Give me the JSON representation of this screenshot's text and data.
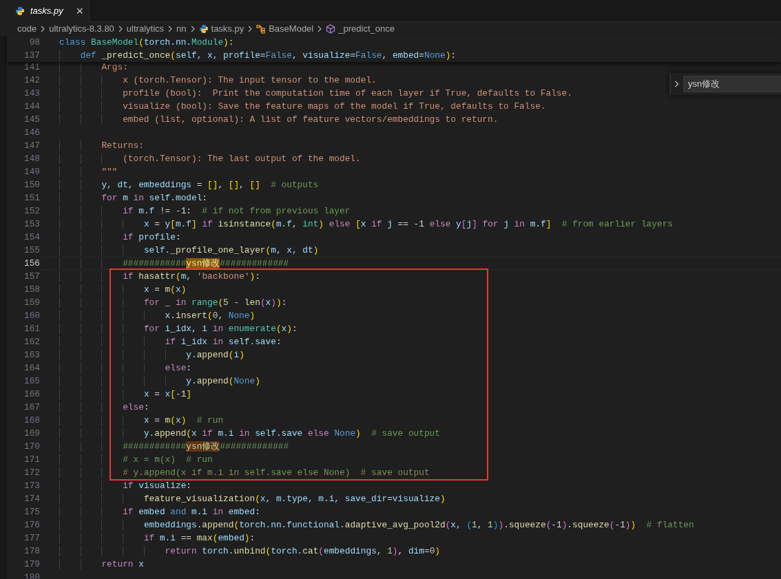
{
  "tab": {
    "title": "tasks.py",
    "close": "×",
    "preview": true
  },
  "breadcrumb": [
    {
      "kind": "folder",
      "label": "code"
    },
    {
      "kind": "folder",
      "label": "ultralytics-8.3.80"
    },
    {
      "kind": "folder",
      "label": "ultralytics"
    },
    {
      "kind": "folder",
      "label": "nn"
    },
    {
      "kind": "python",
      "label": "tasks.py"
    },
    {
      "kind": "class",
      "label": "BaseModel"
    },
    {
      "kind": "method",
      "label": "_predict_once"
    }
  ],
  "find": {
    "value": "ysn修改"
  },
  "sticky_lines": [
    {
      "number": "98",
      "tokens": [
        {
          "kind": "keyword",
          "text": "class "
        },
        {
          "kind": "class",
          "text": "BaseModel"
        },
        {
          "kind": "bracket1",
          "text": "("
        },
        {
          "kind": "variable",
          "text": "torch.nn."
        },
        {
          "kind": "class",
          "text": "Module"
        },
        {
          "kind": "bracket1",
          "text": ")"
        },
        {
          "kind": "plain",
          "text": ":"
        }
      ]
    },
    {
      "number": "137",
      "tokens": [
        {
          "kind": "keyword",
          "text": "    def "
        },
        {
          "kind": "function",
          "text": "_predict_once"
        },
        {
          "kind": "bracket1",
          "text": "("
        },
        {
          "kind": "variable",
          "text": "self, x, profile"
        },
        {
          "kind": "plain",
          "text": "="
        },
        {
          "kind": "keyword",
          "text": "False"
        },
        {
          "kind": "plain",
          "text": ", "
        },
        {
          "kind": "variable",
          "text": "visualize"
        },
        {
          "kind": "plain",
          "text": "="
        },
        {
          "kind": "keyword",
          "text": "False"
        },
        {
          "kind": "plain",
          "text": ", "
        },
        {
          "kind": "variable",
          "text": "embed"
        },
        {
          "kind": "plain",
          "text": "="
        },
        {
          "kind": "keyword",
          "text": "None"
        },
        {
          "kind": "bracket1",
          "text": ")"
        },
        {
          "kind": "plain",
          "text": ":"
        }
      ]
    }
  ],
  "lines": [
    {
      "number": "141",
      "current": false,
      "tokens": [
        {
          "kind": "string",
          "text": "        Args:"
        }
      ]
    },
    {
      "number": "142",
      "current": false,
      "tokens": [
        {
          "kind": "string",
          "text": "            x (torch.Tensor): The input tensor to the model."
        }
      ]
    },
    {
      "number": "143",
      "current": false,
      "tokens": [
        {
          "kind": "string",
          "text": "            profile (bool):  Print the computation time of each layer if True, defaults to False."
        }
      ]
    },
    {
      "number": "144",
      "current": false,
      "tokens": [
        {
          "kind": "string",
          "text": "            visualize (bool): Save the feature maps of the model if True, defaults to False."
        }
      ]
    },
    {
      "number": "145",
      "current": false,
      "tokens": [
        {
          "kind": "string",
          "text": "            embed (list, optional): A list of feature vectors/embeddings to return."
        }
      ]
    },
    {
      "number": "146",
      "current": false
    },
    {
      "number": "147",
      "current": false,
      "tokens": [
        {
          "kind": "string",
          "text": "        Returns:"
        }
      ]
    },
    {
      "number": "148",
      "current": false,
      "tokens": [
        {
          "kind": "string",
          "text": "            (torch.Tensor): The last output of the model."
        }
      ]
    },
    {
      "number": "149",
      "current": false,
      "tokens": [
        {
          "kind": "string",
          "text": "        \"\"\""
        }
      ]
    },
    {
      "number": "150",
      "current": false,
      "tokens": [
        {
          "kind": "variable",
          "text": "        y, dt, embeddings "
        },
        {
          "kind": "plain",
          "text": "= "
        },
        {
          "kind": "bracket1",
          "text": "[]"
        },
        {
          "kind": "plain",
          "text": ", "
        },
        {
          "kind": "bracket1",
          "text": "[]"
        },
        {
          "kind": "plain",
          "text": ", "
        },
        {
          "kind": "bracket1",
          "text": "[]"
        },
        {
          "kind": "comment",
          "text": "  # outputs"
        }
      ]
    },
    {
      "number": "151",
      "current": false,
      "tokens": [
        {
          "kind": "control",
          "text": "        for "
        },
        {
          "kind": "variable",
          "text": "m "
        },
        {
          "kind": "control",
          "text": "in "
        },
        {
          "kind": "variable",
          "text": "self.model"
        },
        {
          "kind": "plain",
          "text": ":"
        }
      ]
    },
    {
      "number": "152",
      "current": false,
      "tokens": [
        {
          "kind": "control",
          "text": "            if "
        },
        {
          "kind": "variable",
          "text": "m.f "
        },
        {
          "kind": "plain",
          "text": "!= -1:"
        },
        {
          "kind": "comment",
          "text": "  # if not from previous layer"
        }
      ]
    },
    {
      "number": "153",
      "current": false,
      "tokens": [
        {
          "kind": "variable",
          "text": "                x "
        },
        {
          "kind": "plain",
          "text": "= "
        },
        {
          "kind": "variable",
          "text": "y"
        },
        {
          "kind": "bracket1",
          "text": "["
        },
        {
          "kind": "variable",
          "text": "m.f"
        },
        {
          "kind": "bracket1",
          "text": "]"
        },
        {
          "kind": "control",
          "text": " if "
        },
        {
          "kind": "function",
          "text": "isinstance"
        },
        {
          "kind": "bracket1",
          "text": "("
        },
        {
          "kind": "variable",
          "text": "m.f"
        },
        {
          "kind": "plain",
          "text": ", "
        },
        {
          "kind": "class",
          "text": "int"
        },
        {
          "kind": "bracket1",
          "text": ")"
        },
        {
          "kind": "control",
          "text": " else "
        },
        {
          "kind": "bracket1",
          "text": "["
        },
        {
          "kind": "variable",
          "text": "x "
        },
        {
          "kind": "control",
          "text": "if "
        },
        {
          "kind": "variable",
          "text": "j "
        },
        {
          "kind": "plain",
          "text": "== -1 "
        },
        {
          "kind": "control",
          "text": "else "
        },
        {
          "kind": "variable",
          "text": "y"
        },
        {
          "kind": "bracket2",
          "text": "["
        },
        {
          "kind": "variable",
          "text": "j"
        },
        {
          "kind": "bracket2",
          "text": "]"
        },
        {
          "kind": "control",
          "text": " for "
        },
        {
          "kind": "variable",
          "text": "j "
        },
        {
          "kind": "control",
          "text": "in "
        },
        {
          "kind": "variable",
          "text": "m.f"
        },
        {
          "kind": "bracket1",
          "text": "]"
        },
        {
          "kind": "comment",
          "text": "  # from earlier layers"
        }
      ]
    },
    {
      "number": "154",
      "current": false,
      "tokens": [
        {
          "kind": "control",
          "text": "            if "
        },
        {
          "kind": "variable",
          "text": "profile"
        },
        {
          "kind": "plain",
          "text": ":"
        }
      ]
    },
    {
      "number": "155",
      "current": false,
      "tokens": [
        {
          "kind": "variable",
          "text": "                self."
        },
        {
          "kind": "function",
          "text": "_profile_one_layer"
        },
        {
          "kind": "bracket1",
          "text": "("
        },
        {
          "kind": "variable",
          "text": "m, x, dt"
        },
        {
          "kind": "bracket1",
          "text": ")"
        }
      ]
    },
    {
      "number": "156",
      "current": true,
      "tokens": [
        {
          "kind": "comment",
          "text": "            ############"
        },
        {
          "kind": "current-match",
          "text": "ysn修改"
        },
        {
          "kind": "comment",
          "text": "#############"
        }
      ]
    },
    {
      "number": "157",
      "current": false,
      "tokens": [
        {
          "kind": "control",
          "text": "            if "
        },
        {
          "kind": "function",
          "text": "hasattr"
        },
        {
          "kind": "bracket1",
          "text": "("
        },
        {
          "kind": "variable",
          "text": "m"
        },
        {
          "kind": "plain",
          "text": ", "
        },
        {
          "kind": "string",
          "text": "'backbone'"
        },
        {
          "kind": "bracket1",
          "text": ")"
        },
        {
          "kind": "plain",
          "text": ":"
        }
      ]
    },
    {
      "number": "158",
      "current": false,
      "tokens": [
        {
          "kind": "variable",
          "text": "                x "
        },
        {
          "kind": "plain",
          "text": "= "
        },
        {
          "kind": "function",
          "text": "m"
        },
        {
          "kind": "bracket1",
          "text": "("
        },
        {
          "kind": "variable",
          "text": "x"
        },
        {
          "kind": "bracket1",
          "text": ")"
        }
      ]
    },
    {
      "number": "159",
      "current": false,
      "tokens": [
        {
          "kind": "control",
          "text": "                for "
        },
        {
          "kind": "variable",
          "text": "_ "
        },
        {
          "kind": "control",
          "text": "in "
        },
        {
          "kind": "class",
          "text": "range"
        },
        {
          "kind": "bracket1",
          "text": "("
        },
        {
          "kind": "number",
          "text": "5"
        },
        {
          "kind": "plain",
          "text": " - "
        },
        {
          "kind": "function",
          "text": "len"
        },
        {
          "kind": "bracket2",
          "text": "("
        },
        {
          "kind": "variable",
          "text": "x"
        },
        {
          "kind": "bracket2",
          "text": ")"
        },
        {
          "kind": "bracket1",
          "text": ")"
        },
        {
          "kind": "plain",
          "text": ":"
        }
      ]
    },
    {
      "number": "160",
      "current": false,
      "tokens": [
        {
          "kind": "variable",
          "text": "                    x."
        },
        {
          "kind": "function",
          "text": "insert"
        },
        {
          "kind": "bracket1",
          "text": "("
        },
        {
          "kind": "number",
          "text": "0"
        },
        {
          "kind": "plain",
          "text": ", "
        },
        {
          "kind": "keyword",
          "text": "None"
        },
        {
          "kind": "bracket1",
          "text": ")"
        }
      ]
    },
    {
      "number": "161",
      "current": false,
      "tokens": [
        {
          "kind": "control",
          "text": "                for "
        },
        {
          "kind": "variable",
          "text": "i_idx, i "
        },
        {
          "kind": "control",
          "text": "in "
        },
        {
          "kind": "class",
          "text": "enumerate"
        },
        {
          "kind": "bracket1",
          "text": "("
        },
        {
          "kind": "variable",
          "text": "x"
        },
        {
          "kind": "bracket1",
          "text": ")"
        },
        {
          "kind": "plain",
          "text": ":"
        }
      ]
    },
    {
      "number": "162",
      "current": false,
      "tokens": [
        {
          "kind": "control",
          "text": "                    if "
        },
        {
          "kind": "variable",
          "text": "i_idx "
        },
        {
          "kind": "control",
          "text": "in "
        },
        {
          "kind": "variable",
          "text": "self.save"
        },
        {
          "kind": "plain",
          "text": ":"
        }
      ]
    },
    {
      "number": "163",
      "current": false,
      "tokens": [
        {
          "kind": "variable",
          "text": "                        y."
        },
        {
          "kind": "function",
          "text": "append"
        },
        {
          "kind": "bracket1",
          "text": "("
        },
        {
          "kind": "variable",
          "text": "i"
        },
        {
          "kind": "bracket1",
          "text": ")"
        }
      ]
    },
    {
      "number": "164",
      "current": false,
      "tokens": [
        {
          "kind": "control",
          "text": "                    else"
        },
        {
          "kind": "plain",
          "text": ":"
        }
      ]
    },
    {
      "number": "165",
      "current": false,
      "tokens": [
        {
          "kind": "variable",
          "text": "                        y."
        },
        {
          "kind": "function",
          "text": "append"
        },
        {
          "kind": "bracket1",
          "text": "("
        },
        {
          "kind": "keyword",
          "text": "None"
        },
        {
          "kind": "bracket1",
          "text": ")"
        }
      ]
    },
    {
      "number": "166",
      "current": false,
      "tokens": [
        {
          "kind": "variable",
          "text": "                x "
        },
        {
          "kind": "plain",
          "text": "= "
        },
        {
          "kind": "variable",
          "text": "x"
        },
        {
          "kind": "bracket1",
          "text": "["
        },
        {
          "kind": "plain",
          "text": "-1"
        },
        {
          "kind": "bracket1",
          "text": "]"
        }
      ]
    },
    {
      "number": "167",
      "current": false,
      "tokens": [
        {
          "kind": "control",
          "text": "            else"
        },
        {
          "kind": "plain",
          "text": ":"
        }
      ]
    },
    {
      "number": "168",
      "current": false,
      "tokens": [
        {
          "kind": "variable",
          "text": "                x "
        },
        {
          "kind": "plain",
          "text": "= "
        },
        {
          "kind": "function",
          "text": "m"
        },
        {
          "kind": "bracket1",
          "text": "("
        },
        {
          "kind": "variable",
          "text": "x"
        },
        {
          "kind": "bracket1",
          "text": ")"
        },
        {
          "kind": "comment",
          "text": "  # run"
        }
      ]
    },
    {
      "number": "169",
      "current": false,
      "tokens": [
        {
          "kind": "variable",
          "text": "                y."
        },
        {
          "kind": "function",
          "text": "append"
        },
        {
          "kind": "bracket1",
          "text": "("
        },
        {
          "kind": "variable",
          "text": "x "
        },
        {
          "kind": "control",
          "text": "if "
        },
        {
          "kind": "variable",
          "text": "m.i "
        },
        {
          "kind": "control",
          "text": "in "
        },
        {
          "kind": "variable",
          "text": "self.save "
        },
        {
          "kind": "control",
          "text": "else "
        },
        {
          "kind": "keyword",
          "text": "None"
        },
        {
          "kind": "bracket1",
          "text": ")"
        },
        {
          "kind": "comment",
          "text": "  # save output"
        }
      ]
    },
    {
      "number": "170",
      "current": false,
      "tokens": [
        {
          "kind": "comment",
          "text": "            ############"
        },
        {
          "kind": "match",
          "text": "ysn修改"
        },
        {
          "kind": "comment",
          "text": "#############"
        }
      ]
    },
    {
      "number": "171",
      "current": false,
      "tokens": [
        {
          "kind": "comment",
          "text": "            # x = m(x)  # run"
        }
      ]
    },
    {
      "number": "172",
      "current": false,
      "tokens": [
        {
          "kind": "comment",
          "text": "            # y.append(x if m.i in self.save else None)  # save output"
        }
      ]
    },
    {
      "number": "173",
      "current": false,
      "tokens": [
        {
          "kind": "control",
          "text": "            if "
        },
        {
          "kind": "variable",
          "text": "visualize"
        },
        {
          "kind": "plain",
          "text": ":"
        }
      ]
    },
    {
      "number": "174",
      "current": false,
      "tokens": [
        {
          "kind": "function",
          "text": "                feature_visualization"
        },
        {
          "kind": "bracket1",
          "text": "("
        },
        {
          "kind": "variable",
          "text": "x, m.type, m.i, save_dir"
        },
        {
          "kind": "plain",
          "text": "="
        },
        {
          "kind": "variable",
          "text": "visualize"
        },
        {
          "kind": "bracket1",
          "text": ")"
        }
      ]
    },
    {
      "number": "175",
      "current": false,
      "tokens": [
        {
          "kind": "control",
          "text": "            if "
        },
        {
          "kind": "variable",
          "text": "embed "
        },
        {
          "kind": "keyword",
          "text": "and "
        },
        {
          "kind": "variable",
          "text": "m.i "
        },
        {
          "kind": "control",
          "text": "in "
        },
        {
          "kind": "variable",
          "text": "embed"
        },
        {
          "kind": "plain",
          "text": ":"
        }
      ]
    },
    {
      "number": "176",
      "current": false,
      "tokens": [
        {
          "kind": "variable",
          "text": "                embeddings."
        },
        {
          "kind": "function",
          "text": "append"
        },
        {
          "kind": "bracket1",
          "text": "("
        },
        {
          "kind": "variable",
          "text": "torch.nn.functional."
        },
        {
          "kind": "function",
          "text": "adaptive_avg_pool2d"
        },
        {
          "kind": "bracket2",
          "text": "("
        },
        {
          "kind": "variable",
          "text": "x, "
        },
        {
          "kind": "bracket3",
          "text": "("
        },
        {
          "kind": "number",
          "text": "1"
        },
        {
          "kind": "plain",
          "text": ", "
        },
        {
          "kind": "number",
          "text": "1"
        },
        {
          "kind": "bracket3",
          "text": ")"
        },
        {
          "kind": "bracket2",
          "text": ")"
        },
        {
          "kind": "plain",
          "text": "."
        },
        {
          "kind": "function",
          "text": "squeeze"
        },
        {
          "kind": "bracket2",
          "text": "("
        },
        {
          "kind": "plain",
          "text": "-1"
        },
        {
          "kind": "bracket2",
          "text": ")"
        },
        {
          "kind": "plain",
          "text": "."
        },
        {
          "kind": "function",
          "text": "squeeze"
        },
        {
          "kind": "bracket2",
          "text": "("
        },
        {
          "kind": "plain",
          "text": "-1"
        },
        {
          "kind": "bracket2",
          "text": ")"
        },
        {
          "kind": "bracket1",
          "text": ")"
        },
        {
          "kind": "comment",
          "text": "  # flatten"
        }
      ]
    },
    {
      "number": "177",
      "current": false,
      "tokens": [
        {
          "kind": "control",
          "text": "                if "
        },
        {
          "kind": "variable",
          "text": "m.i "
        },
        {
          "kind": "plain",
          "text": "== "
        },
        {
          "kind": "function",
          "text": "max"
        },
        {
          "kind": "bracket1",
          "text": "("
        },
        {
          "kind": "variable",
          "text": "embed"
        },
        {
          "kind": "bracket1",
          "text": ")"
        },
        {
          "kind": "plain",
          "text": ":"
        }
      ]
    },
    {
      "number": "178",
      "current": false,
      "tokens": [
        {
          "kind": "control",
          "text": "                    return "
        },
        {
          "kind": "variable",
          "text": "torch."
        },
        {
          "kind": "function",
          "text": "unbind"
        },
        {
          "kind": "bracket1",
          "text": "("
        },
        {
          "kind": "variable",
          "text": "torch."
        },
        {
          "kind": "function",
          "text": "cat"
        },
        {
          "kind": "bracket2",
          "text": "("
        },
        {
          "kind": "variable",
          "text": "embeddings"
        },
        {
          "kind": "plain",
          "text": ", "
        },
        {
          "kind": "number",
          "text": "1"
        },
        {
          "kind": "bracket2",
          "text": ")"
        },
        {
          "kind": "plain",
          "text": ", "
        },
        {
          "kind": "variable",
          "text": "dim"
        },
        {
          "kind": "plain",
          "text": "="
        },
        {
          "kind": "number",
          "text": "0"
        },
        {
          "kind": "bracket1",
          "text": ")"
        }
      ]
    },
    {
      "number": "179",
      "current": false,
      "tokens": [
        {
          "kind": "control",
          "text": "        return "
        },
        {
          "kind": "variable",
          "text": "x"
        }
      ]
    },
    {
      "number": "180",
      "current": false
    }
  ]
}
